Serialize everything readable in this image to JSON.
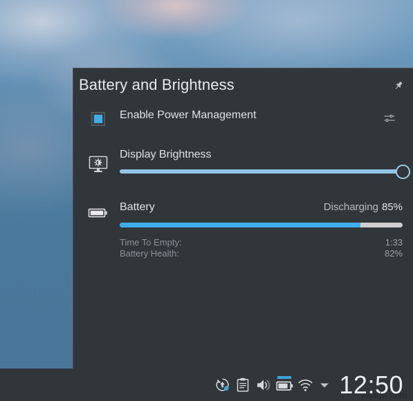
{
  "popup": {
    "title": "Battery and Brightness",
    "pin_icon": "pin-icon",
    "power": {
      "label": "Enable Power Management",
      "checked": true,
      "checkbox_icon": "checkbox-checked-icon",
      "config_icon": "sliders-settings-icon"
    },
    "brightness": {
      "label": "Display Brightness",
      "icon": "monitor-brightness-icon",
      "value": 100,
      "min": 0,
      "max": 100
    },
    "battery": {
      "label": "Battery",
      "icon": "battery-icon",
      "state": "Discharging",
      "percent_label": "85%",
      "percent": 85,
      "details": [
        {
          "label": "Time To Empty:",
          "value": "1:33"
        },
        {
          "label": "Battery Health:",
          "value": "82%"
        }
      ]
    }
  },
  "panel": {
    "tray": [
      {
        "name": "updates-icon",
        "label": "Updates"
      },
      {
        "name": "clipboard-icon",
        "label": "Clipboard"
      },
      {
        "name": "volume-icon",
        "label": "Volume"
      },
      {
        "name": "battery-tray-icon",
        "label": "Battery and Brightness"
      },
      {
        "name": "wifi-icon",
        "label": "Networks"
      }
    ],
    "expand_arrow_icon": "chevron-down-icon",
    "clock": "12:50"
  },
  "watermark": "wsxdn.com",
  "colors": {
    "accent": "#3daee9",
    "slider_fill": "#93c5e4",
    "popup_bg": "#31363b",
    "panel_bg": "#31363b",
    "text": "#dfe2e4",
    "text_dim": "#8b9197",
    "progress_remaining": "#cfcfcf"
  }
}
